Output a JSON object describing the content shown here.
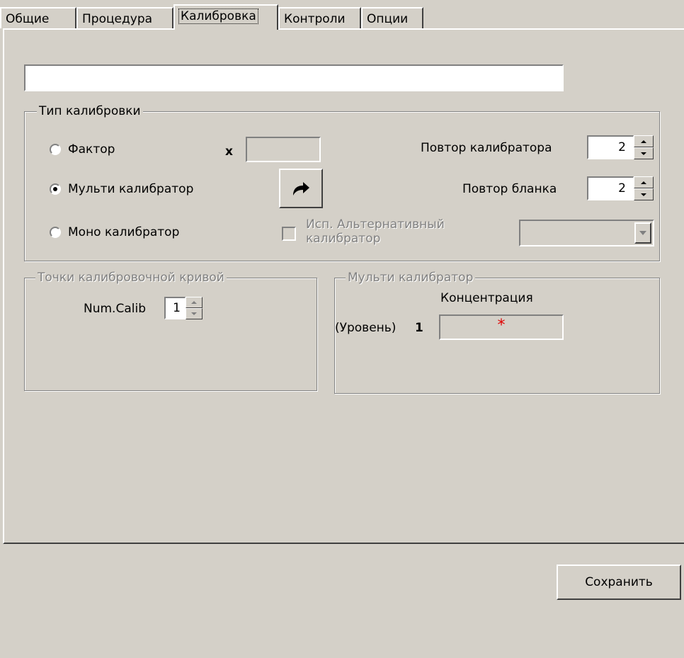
{
  "tabs": [
    {
      "label": "Общие"
    },
    {
      "label": "Процедура"
    },
    {
      "label": "Калибровка"
    },
    {
      "label": "Контроли"
    },
    {
      "label": "Опции"
    }
  ],
  "calib_type": {
    "title": "Тип калибровки",
    "options": {
      "factor": "Фактор",
      "multi": "Мульти калибратор",
      "mono": "Моно калибратор"
    },
    "selected": "multi",
    "factor_x": "x",
    "calibrator_repeat_label": "Повтор калибратора",
    "calibrator_repeat_value": "2",
    "blank_repeat_label": "Повтор бланка",
    "blank_repeat_value": "2",
    "alt_calibrator_label_line1": "Исп. Альтернативный",
    "alt_calibrator_label_line2": "калибратор"
  },
  "curve_points": {
    "title": "Точки калибровочной кривой",
    "num_calib_label": "Num.Calib",
    "num_calib_value": "1"
  },
  "multi_calib": {
    "title": "Мульти калибратор",
    "concentration_label": "Концентрация",
    "level_label": "(Уровень)",
    "level_number": "1",
    "required_mark": "*"
  },
  "save_label": "Сохранить",
  "colors": {
    "required": "#e00000",
    "face": "#d4d0c8"
  }
}
